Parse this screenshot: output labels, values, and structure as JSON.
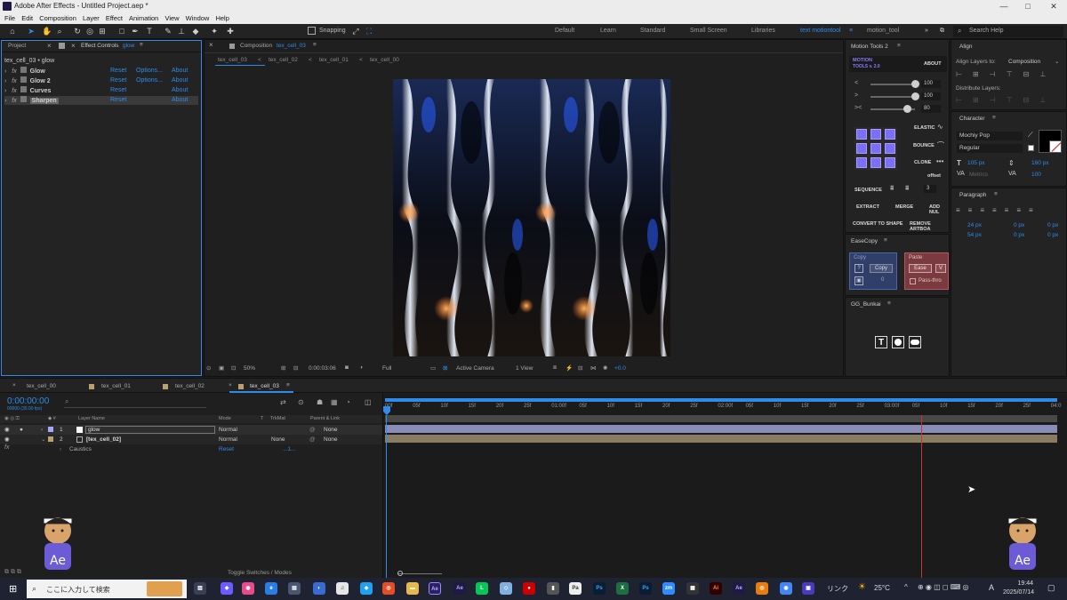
{
  "window": {
    "title": "Adobe After Effects - Untitled Project.aep *",
    "minimize": "—",
    "maximize": "□",
    "close": "✕"
  },
  "menu": [
    "File",
    "Edit",
    "Composition",
    "Layer",
    "Effect",
    "Animation",
    "View",
    "Window",
    "Help"
  ],
  "toolbar": {
    "snapping": "Snapping",
    "workspaces": [
      "Default",
      "Learn",
      "Standard",
      "Small Screen",
      "Libraries",
      "text motiontool",
      "motion_tool"
    ],
    "active_workspace": "text motiontool",
    "search": "Search Help",
    "more": "»"
  },
  "project_panel": {
    "tab_project": "Project",
    "tab_effects": "Effect Controls",
    "effects_layer": "glow",
    "breadcrumb": "tex_cell_03 • glow",
    "effects": [
      {
        "fx": "fx",
        "name": "Glow",
        "reset": "Reset",
        "options": "Options...",
        "about": "About"
      },
      {
        "fx": "fx",
        "name": "Glow 2",
        "reset": "Reset",
        "options": "Options...",
        "about": "About"
      },
      {
        "fx": "fx",
        "name": "Curves",
        "reset": "Reset",
        "options": "",
        "about": "About"
      },
      {
        "fx": "fx",
        "name": "Sharpen",
        "reset": "Reset",
        "options": "",
        "about": "About"
      }
    ]
  },
  "composition": {
    "tab_label": "Composition",
    "comp_name": "tex_cell_03",
    "flow": [
      "tex_cell_03",
      "tex_cell_02",
      "tex_cell_01",
      "tex_cell_00"
    ],
    "flow_sep": "<",
    "footer": {
      "zoom": "50%",
      "timecode": "0:00:03:06",
      "quality": "Full",
      "camera": "Active Camera",
      "view": "1 View",
      "exposure": "+0.0"
    }
  },
  "motion_tools": {
    "title": "Motion Tools 2",
    "logo_line1": "MOTION",
    "logo_line2": "TOOLS v. 2.0",
    "about": "ABOUT",
    "sliders": [
      {
        "symbol": "<",
        "value": "100",
        "level": 1.0
      },
      {
        "symbol": ">",
        "value": "100",
        "level": 1.0
      },
      {
        "symbol": "><",
        "value": "80",
        "level": 0.8
      }
    ],
    "elastic": "ELASTIC",
    "bounce": "BOUNCE",
    "clone": "CLONE",
    "offset": "offset",
    "sequence": "SEQUENCE",
    "sequence_value": "3",
    "extract": "EXTRACT",
    "merge": "MERGE",
    "add_null": "ADD NUL",
    "convert_to_shape": "CONVERT TO SHAPE",
    "remove_artboard": "REMOVE ARTBOA"
  },
  "easecopy": {
    "title": "EaseCopy",
    "copy_label": "Copy",
    "copy_btn": "Copy",
    "copy_value": "0",
    "paste_label": "Paste",
    "ease_btn": "Ease",
    "v_btn": "V",
    "passthrough": "Pass-thro"
  },
  "gg_bunkai": {
    "title": "GG_Bunkai"
  },
  "align": {
    "title": "Align",
    "align_to_label": "Align Layers to:",
    "align_to_value": "Composition",
    "distribute": "Distribute Layers:"
  },
  "character": {
    "title": "Character",
    "font": "Mochiy Pop",
    "style": "Regular",
    "size": "105 px",
    "leading": "160 px",
    "kerning": "Metrics",
    "tracking": "100"
  },
  "paragraph": {
    "title": "Paragraph",
    "indent_left": "24 px",
    "indent_first": "54 px",
    "space_before": "0 px",
    "space_after": "0 px",
    "indent_right": "0 px",
    "space_after2": "0 px"
  },
  "timeline": {
    "tabs": [
      "tex_cell_00",
      "tex_cell_01",
      "tex_cell_02",
      "tex_cell_03"
    ],
    "active_tab": "tex_cell_03",
    "timecode": "0:00:00:00",
    "fps": "00000 (30.00 fps)",
    "search": "⌕",
    "columns": {
      "layer_name": "Layer Name",
      "mode": "Mode",
      "t": "T",
      "trkmat": "TrkMat",
      "parent": "Parent & Link"
    },
    "layers": [
      {
        "num": "1",
        "name": "glow",
        "mode": "Normal",
        "trkmat": "",
        "parent": "None"
      },
      {
        "num": "2",
        "name": "[tex_cell_02]",
        "mode": "Normal",
        "trkmat": "None",
        "parent": "None"
      }
    ],
    "effect_row": {
      "name": "Caustics",
      "reset": "Reset",
      "value": "...1..."
    },
    "fx_label": "fx",
    "ruler": [
      "00f",
      "05f",
      "10f",
      "15f",
      "20f",
      "25f",
      "01:00f",
      "05f",
      "10f",
      "15f",
      "20f",
      "25f",
      "02:00f",
      "05f",
      "10f",
      "15f",
      "20f",
      "25f",
      "03:00f",
      "05f",
      "10f",
      "15f",
      "20f",
      "25f",
      "04:0"
    ],
    "playhead_position_fraction": 0.8,
    "toggle": "Toggle Switches / Modes"
  },
  "taskbar": {
    "search": "ここに入力して検索",
    "link_text": "リンク",
    "temperature": "25°C",
    "ime": "A",
    "time": "19:44",
    "date": "2025/07/14"
  },
  "mascot": {
    "headband": "TAROKI",
    "badge": "Ae"
  },
  "colors": {
    "accent": "#2d8ceb",
    "bg": "#1d1d1d",
    "panel": "#232323",
    "purple": "#7c6ef5",
    "playhead": "#c0392b"
  }
}
